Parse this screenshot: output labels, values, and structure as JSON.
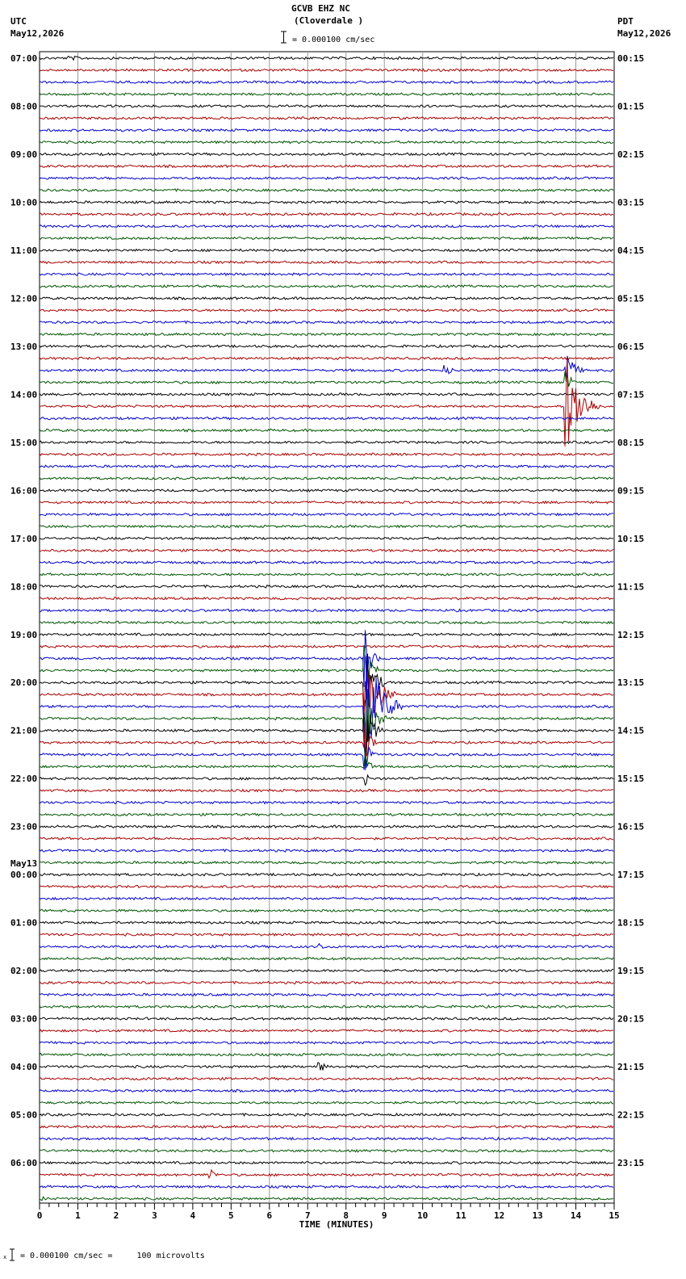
{
  "header": {
    "station": "GCVB EHZ NC",
    "location": "(Cloverdale )",
    "scale_label": "= 0.000100 cm/sec",
    "left_zone": "UTC",
    "left_date": "May12,2026",
    "right_zone": "PDT",
    "right_date": "May12,2026"
  },
  "footer": {
    "scale_note": "= 0.000100 cm/sec =     100 microvolts"
  },
  "chart_data": {
    "type": "line",
    "title": "GCVB EHZ NC (Cloverdale )",
    "xlabel": "TIME (MINUTES)",
    "xlim": [
      0,
      15
    ],
    "x_ticks": [
      "0",
      "1",
      "2",
      "3",
      "4",
      "5",
      "6",
      "7",
      "8",
      "9",
      "10",
      "11",
      "12",
      "13",
      "14",
      "15"
    ],
    "grid": true,
    "trace_minutes_per_line": 15,
    "trace_colors": [
      "#000000",
      "#aa0000",
      "#0000cc",
      "#005500"
    ],
    "utc_hour_labels": [
      "07:00",
      "08:00",
      "09:00",
      "10:00",
      "11:00",
      "12:00",
      "13:00",
      "14:00",
      "15:00",
      "16:00",
      "17:00",
      "18:00",
      "19:00",
      "20:00",
      "21:00",
      "22:00",
      "23:00",
      "00:00",
      "01:00",
      "02:00",
      "03:00",
      "04:00",
      "05:00",
      "06:00"
    ],
    "day_change_label": "May13",
    "pdt_hour_labels": [
      "00:15",
      "01:15",
      "02:15",
      "03:15",
      "04:15",
      "05:15",
      "06:15",
      "07:15",
      "08:15",
      "09:15",
      "10:15",
      "11:15",
      "12:15",
      "13:15",
      "14:15",
      "15:15",
      "16:15",
      "17:15",
      "18:15",
      "19:15",
      "20:15",
      "21:15",
      "22:15",
      "23:15"
    ],
    "events": [
      {
        "trace": 0,
        "minute": 0.8,
        "amplitude": 3,
        "duration": 1.5
      },
      {
        "trace": 26,
        "minute": 10.6,
        "amplitude": 9,
        "duration": 0.4
      },
      {
        "trace": 26,
        "minute": 13.75,
        "amplitude": 28,
        "duration": 0.5
      },
      {
        "trace": 27,
        "minute": 13.75,
        "amplitude": 14,
        "duration": 0.4
      },
      {
        "trace": 29,
        "minute": 13.75,
        "amplitude": 70,
        "duration": 0.9
      },
      {
        "trace": 31,
        "minute": 0.2,
        "amplitude": 4,
        "duration": 0.4
      },
      {
        "trace": 50,
        "minute": 8.5,
        "amplitude": 40,
        "duration": 0.4
      },
      {
        "trace": 51,
        "minute": 8.5,
        "amplitude": 45,
        "duration": 0.4
      },
      {
        "trace": 52,
        "minute": 8.5,
        "amplitude": 50,
        "duration": 0.6
      },
      {
        "trace": 53,
        "minute": 8.5,
        "amplitude": 60,
        "duration": 0.8
      },
      {
        "trace": 54,
        "minute": 8.5,
        "amplitude": 80,
        "duration": 1.0
      },
      {
        "trace": 55,
        "minute": 8.5,
        "amplitude": 50,
        "duration": 0.6
      },
      {
        "trace": 56,
        "minute": 8.5,
        "amplitude": 40,
        "duration": 0.5
      },
      {
        "trace": 57,
        "minute": 8.5,
        "amplitude": 30,
        "duration": 0.4
      },
      {
        "trace": 58,
        "minute": 8.5,
        "amplitude": 25,
        "duration": 0.3
      },
      {
        "trace": 59,
        "minute": 8.5,
        "amplitude": 20,
        "duration": 0.3
      },
      {
        "trace": 60,
        "minute": 8.5,
        "amplitude": 10,
        "duration": 0.3
      },
      {
        "trace": 74,
        "minute": 7.3,
        "amplitude": 5,
        "duration": 0.5
      },
      {
        "trace": 84,
        "minute": 7.3,
        "amplitude": 9,
        "duration": 0.4
      },
      {
        "trace": 93,
        "minute": 4.45,
        "amplitude": 12,
        "duration": 0.3
      },
      {
        "trace": 95,
        "minute": 0.1,
        "amplitude": 4,
        "duration": 0.4
      }
    ]
  }
}
